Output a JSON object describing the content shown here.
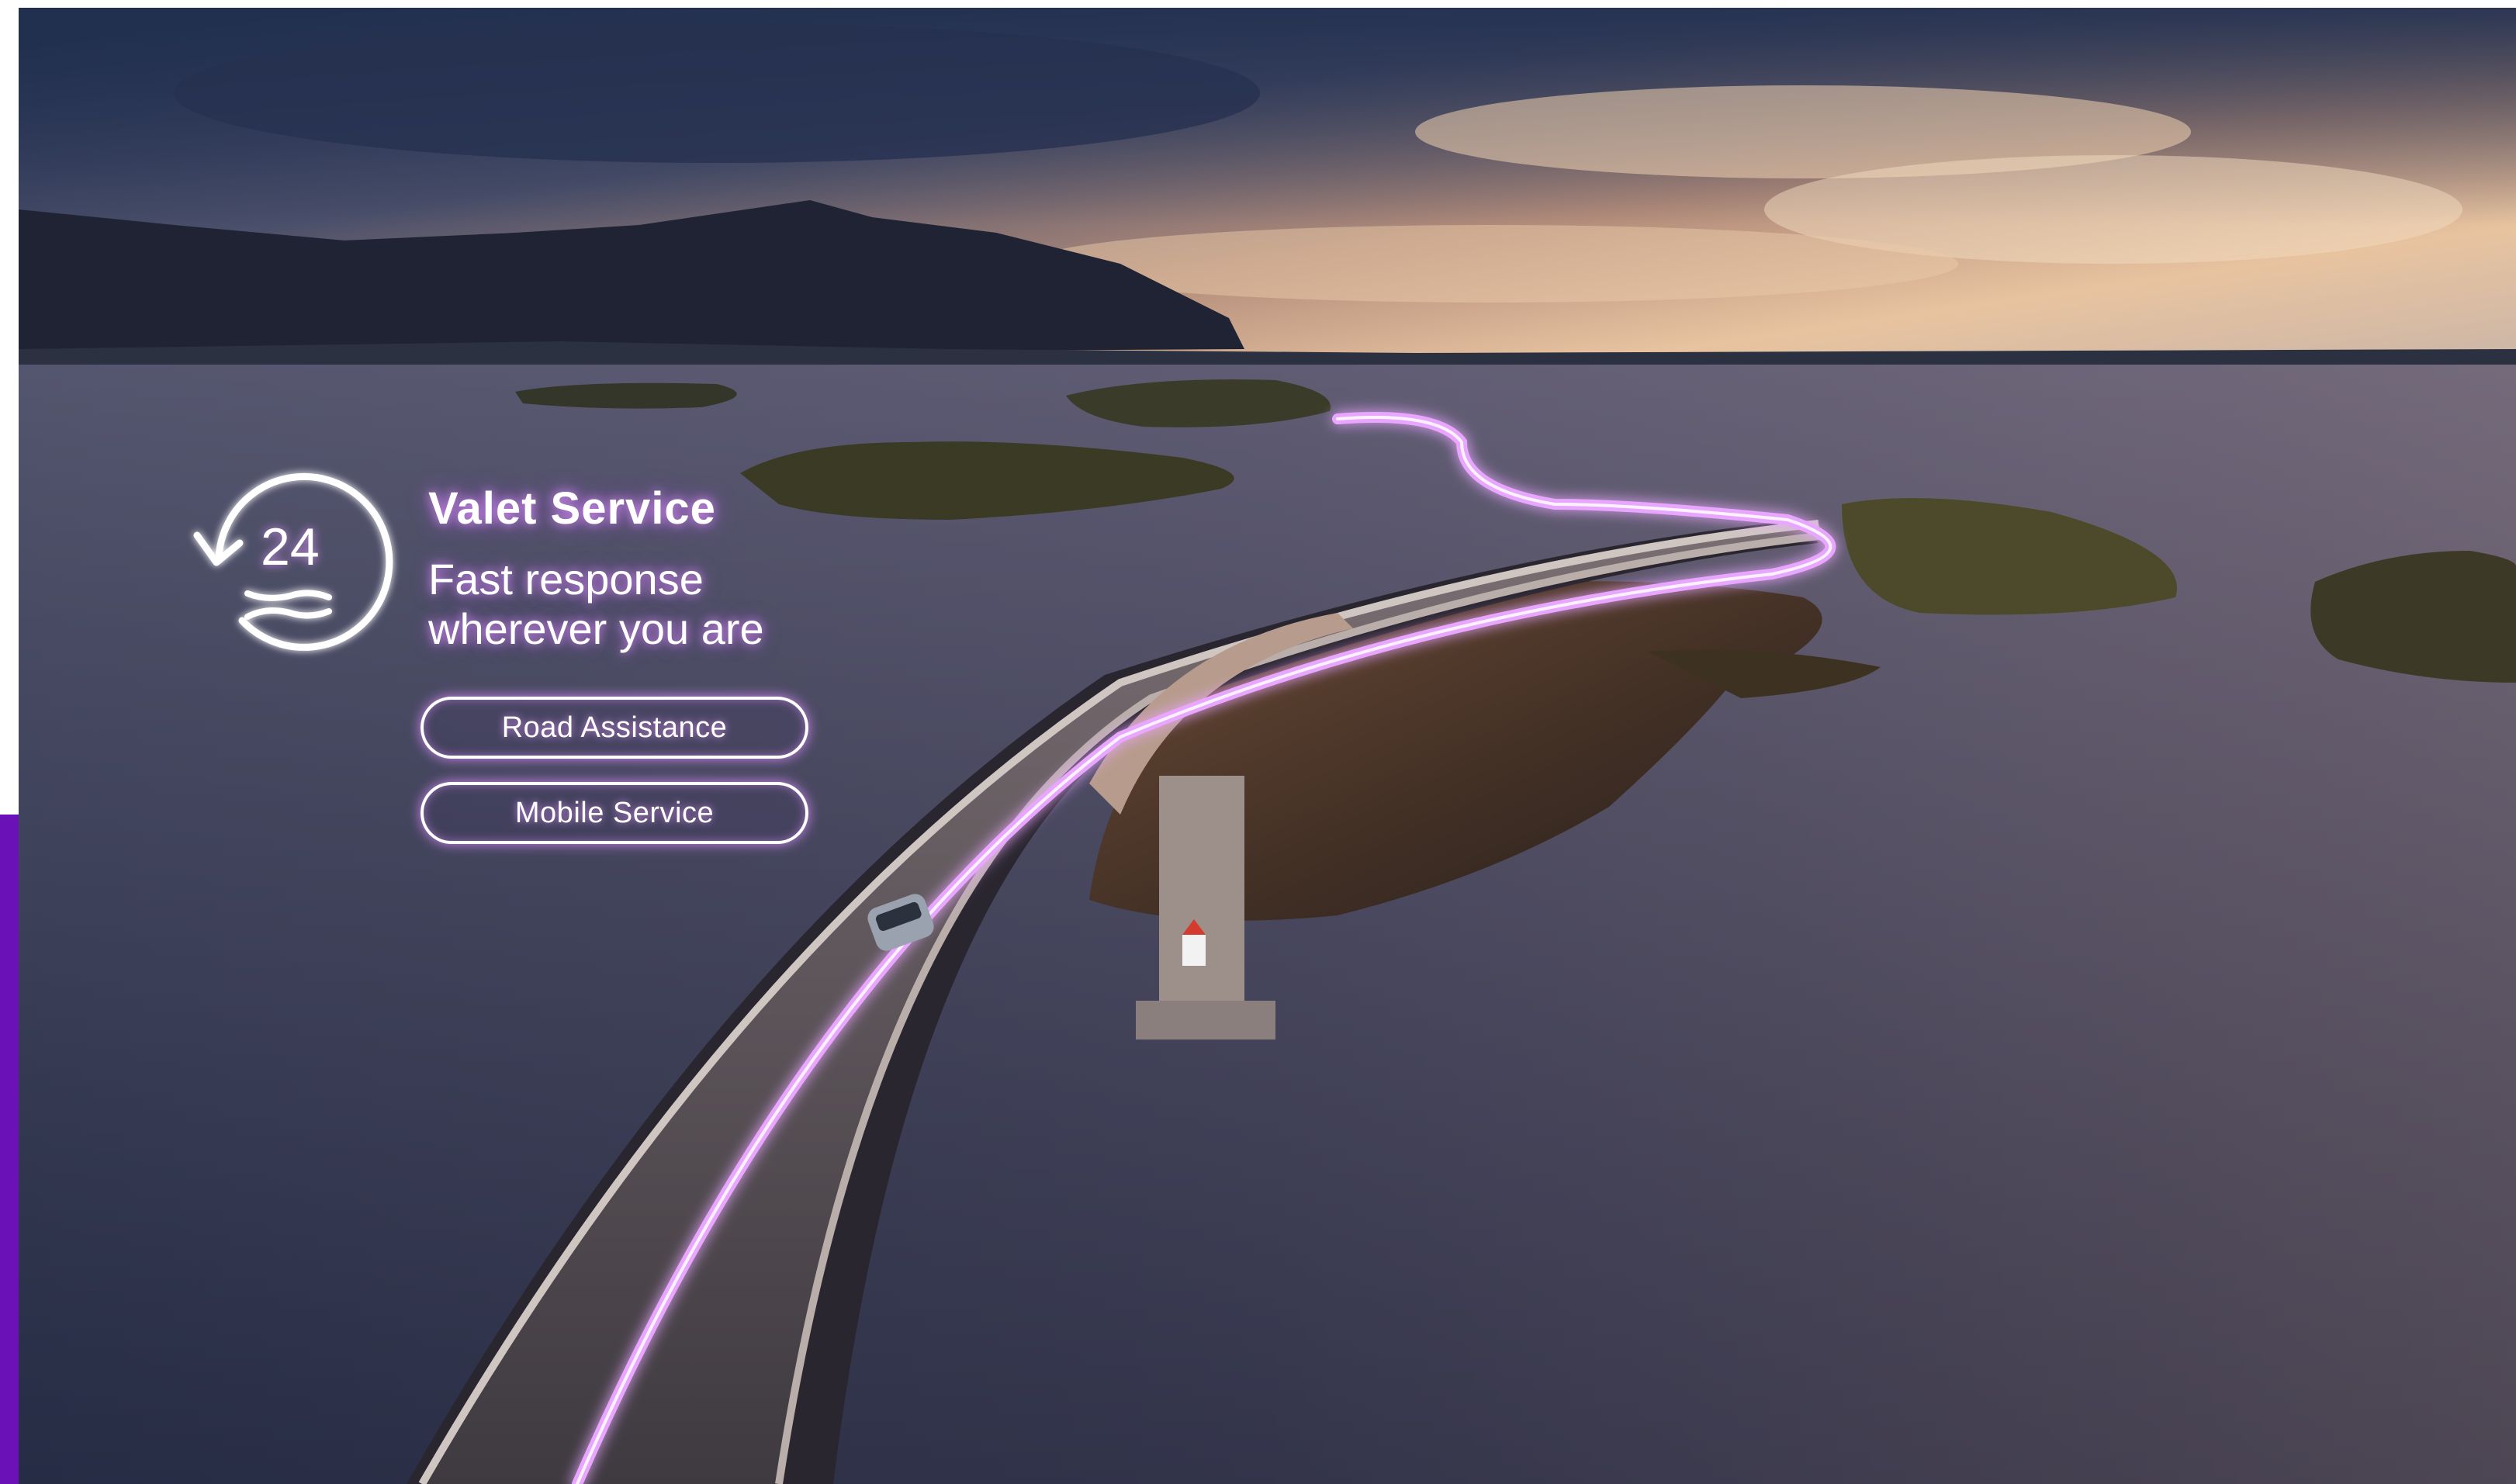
{
  "hero": {
    "title": "Valet Service",
    "subtitle_line1": "Fast response",
    "subtitle_line2": "wherever you are",
    "icon_text": "24",
    "icon": "24h-wrench-service-icon"
  },
  "buttons": {
    "road_assistance": "Road Assistance",
    "mobile_service": "Mobile Service"
  },
  "colors": {
    "accent_purple": "#6a12b8",
    "glow": "#d98cff",
    "sea": "#3e4360",
    "sky_warm": "#e8b48a"
  }
}
